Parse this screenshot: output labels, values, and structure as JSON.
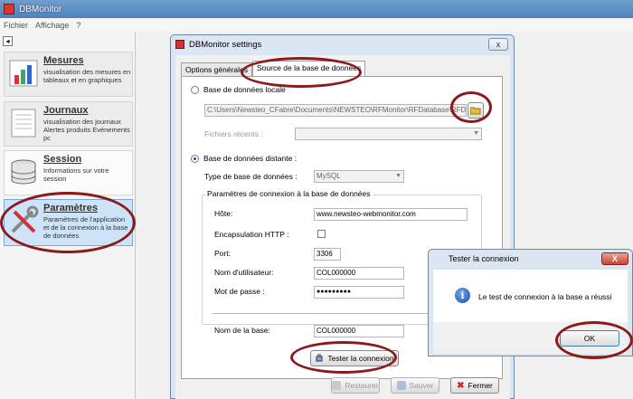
{
  "app": {
    "title": "DBMonitor"
  },
  "menu": {
    "items": [
      "Fichier",
      "Affichage",
      "?"
    ]
  },
  "sidebar": {
    "collapse_glyph": "◂",
    "items": [
      {
        "title": "Mesures",
        "desc": "visualisation des mesures en tableaux et en graphiques",
        "icon": "chart-icon"
      },
      {
        "title": "Journaux",
        "desc": "visualisation des journaux Alertes produits Evénements pc",
        "icon": "journal-icon"
      },
      {
        "title": "Session",
        "desc": "Informations sur votre session",
        "icon": "database-icon"
      },
      {
        "title": "Paramètres",
        "desc": "Paramètres de l'application et de la connexion à la base de données",
        "icon": "tools-icon",
        "selected": true
      }
    ]
  },
  "settings": {
    "title": "DBMonitor settings",
    "close_glyph": "x",
    "tabs": [
      "Options générales",
      "Source de la base de données"
    ],
    "active_tab": 1,
    "local_db": {
      "label": "Base de données locale",
      "path": "C:\\Users\\Newsteo_CFabre\\Documents\\NEWSTEO\\RFMonitor\\RFDatabase\\RFD",
      "recent_label": "Fichiers récents :"
    },
    "remote_db": {
      "label": "Base de données distante :",
      "type_label": "Type de base de données :",
      "type_value": "MySQL",
      "group_title": "Paramètres de connexion à la base de données",
      "host_label": "Hôte:",
      "host_value": "www.newsteo-webmonitor.com",
      "https_label": "Encapsulation HTTP :",
      "port_label": "Port:",
      "port_value": "3306",
      "user_label": "Nom d'utilisateur:",
      "user_value": "COL000000",
      "password_label": "Mot de passe :",
      "password_value": "●●●●●●●●●",
      "dbname_label": "Nom de la base:",
      "dbname_value": "COL000000"
    },
    "buttons": {
      "test": "Tester la connexion",
      "restore": "Restaurer",
      "save": "Sauver",
      "close": "Fermer"
    }
  },
  "msgbox": {
    "title": "Tester la connexion",
    "close_glyph": "X",
    "icon_glyph": "i",
    "message": "Le test de connexion à la base a réussi",
    "ok": "OK"
  },
  "colors": {
    "highlight": "#8b1a1a",
    "selected_nav": "#cde3f7"
  }
}
